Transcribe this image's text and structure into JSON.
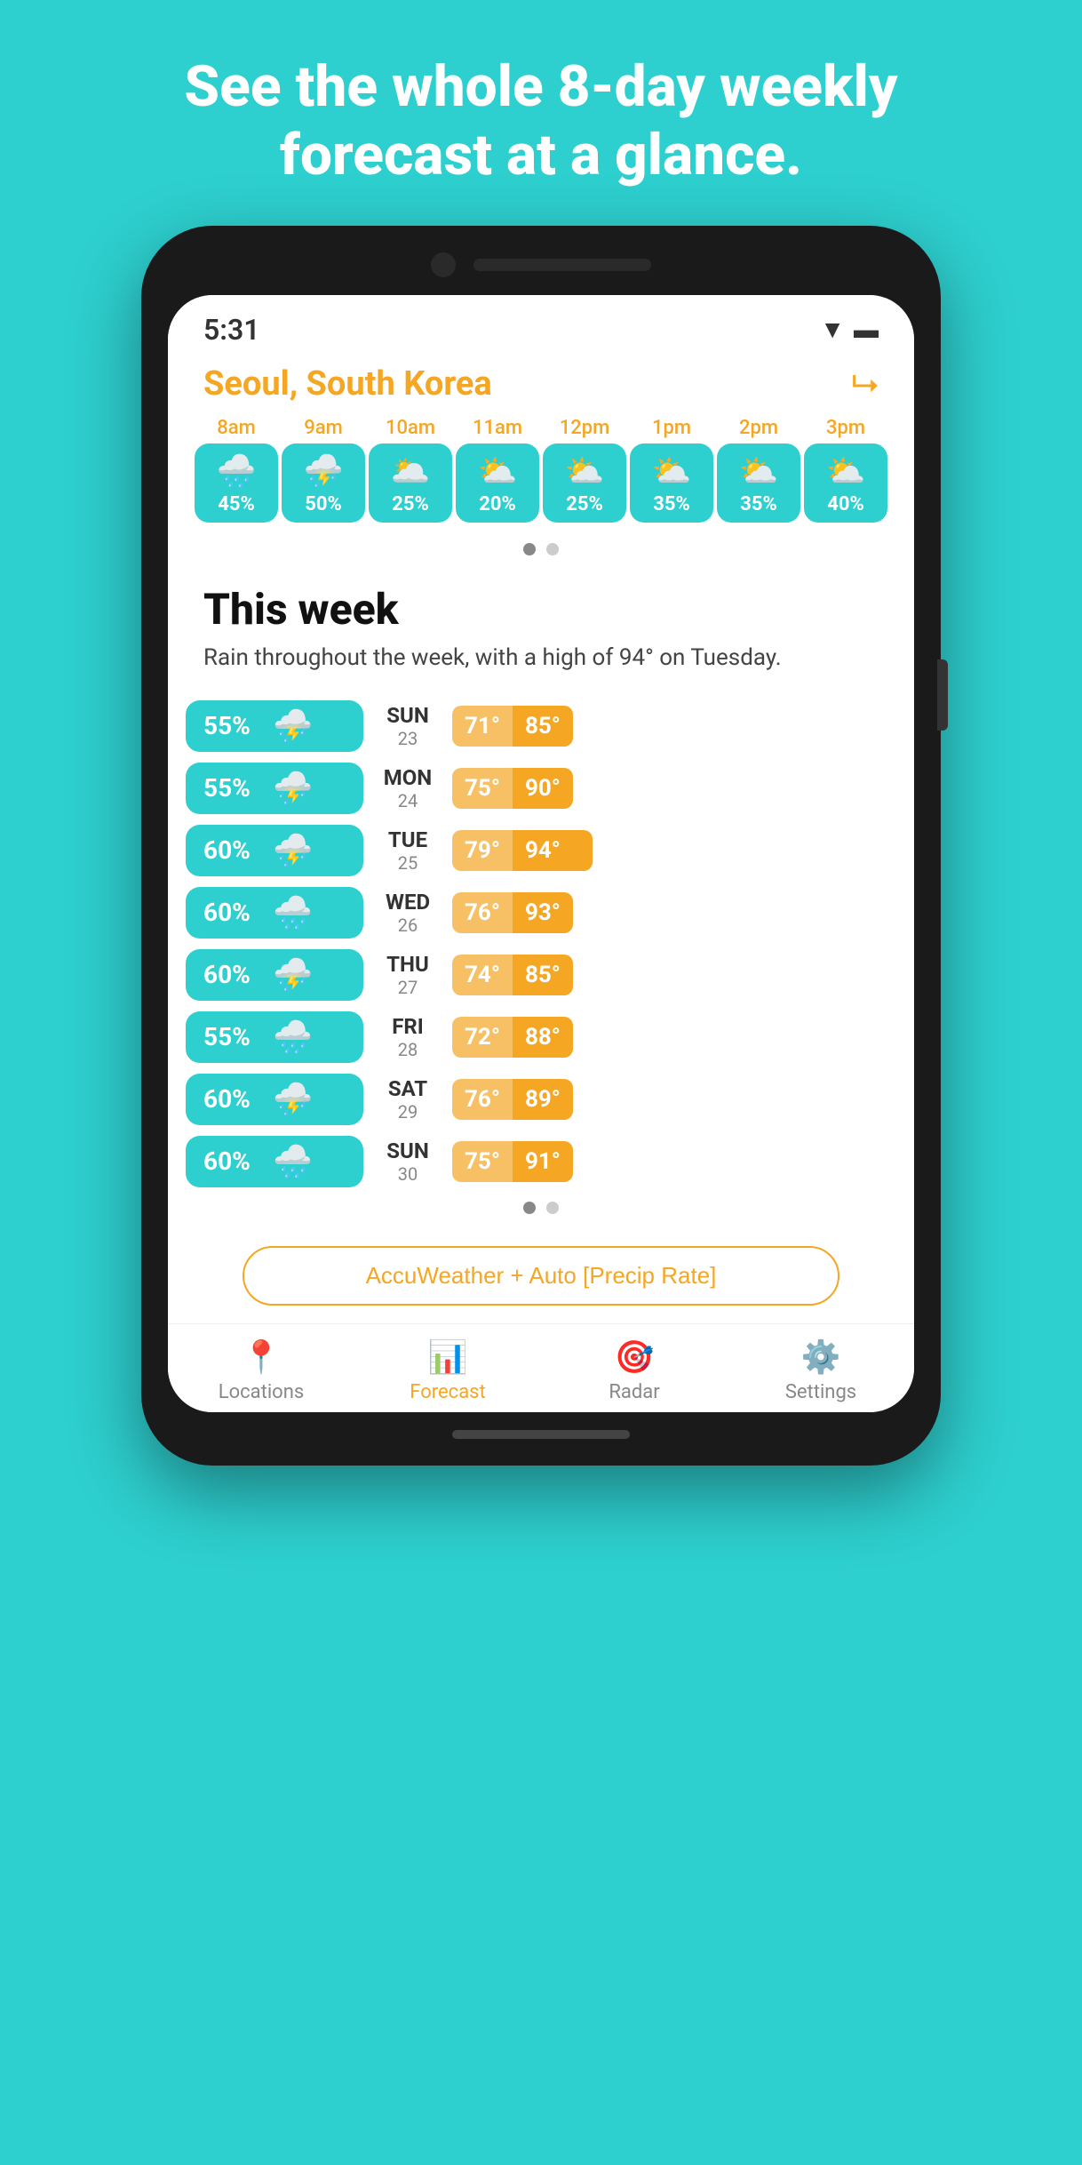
{
  "headline": "See the whole 8-day weekly forecast at a glance.",
  "status": {
    "time": "5:31",
    "wifi": "▼",
    "battery": "🔋"
  },
  "location": {
    "name": "Seoul, South Korea"
  },
  "hourly": {
    "labels": [
      "8am",
      "9am",
      "10am",
      "11am",
      "12pm",
      "1pm",
      "2pm",
      "3pm"
    ],
    "items": [
      {
        "icon": "🌧️",
        "pct": "45%"
      },
      {
        "icon": "⛈️",
        "pct": "50%"
      },
      {
        "icon": "🌥️",
        "pct": "25%"
      },
      {
        "icon": "⛅",
        "pct": "20%"
      },
      {
        "icon": "⛅",
        "pct": "25%"
      },
      {
        "icon": "⛅",
        "pct": "35%"
      },
      {
        "icon": "⛅",
        "pct": "35%"
      },
      {
        "icon": "⛅",
        "pct": "40%"
      }
    ]
  },
  "week": {
    "title": "This week",
    "desc": "Rain throughout the week, with a high of 94° on Tuesday.",
    "days": [
      {
        "name": "SUN",
        "num": "23",
        "pct": "55%",
        "icon": "⛈️",
        "low": "71°",
        "high": "85°"
      },
      {
        "name": "MON",
        "num": "24",
        "pct": "55%",
        "icon": "⛈️",
        "low": "75°",
        "high": "90°"
      },
      {
        "name": "TUE",
        "num": "25",
        "pct": "60%",
        "icon": "⛈️",
        "low": "79°",
        "high": "94°"
      },
      {
        "name": "WED",
        "num": "26",
        "pct": "60%",
        "icon": "🌧️",
        "low": "76°",
        "high": "93°"
      },
      {
        "name": "THU",
        "num": "27",
        "pct": "60%",
        "icon": "⛈️",
        "low": "74°",
        "high": "85°"
      },
      {
        "name": "FRI",
        "num": "28",
        "pct": "55%",
        "icon": "🌧️",
        "low": "72°",
        "high": "88°"
      },
      {
        "name": "SAT",
        "num": "29",
        "pct": "60%",
        "icon": "⛈️",
        "low": "76°",
        "high": "89°"
      },
      {
        "name": "SUN",
        "num": "30",
        "pct": "60%",
        "icon": "🌧️",
        "low": "75°",
        "high": "91°"
      }
    ]
  },
  "source_button": "AccuWeather + Auto [Precip Rate]",
  "nav": {
    "items": [
      {
        "icon": "📍",
        "label": "Locations",
        "active": false
      },
      {
        "icon": "📊",
        "label": "Forecast",
        "active": true
      },
      {
        "icon": "🎯",
        "label": "Radar",
        "active": false
      },
      {
        "icon": "⚙️",
        "label": "Settings",
        "active": false
      }
    ]
  }
}
